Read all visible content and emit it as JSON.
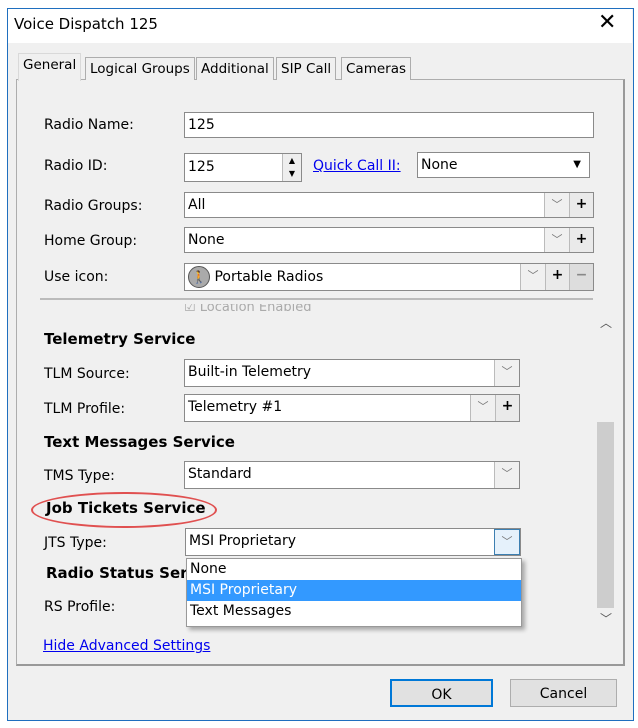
{
  "window": {
    "title": "Voice Dispatch 125",
    "close_icon": "close-icon"
  },
  "tabs": [
    {
      "label": "General"
    },
    {
      "label": "Logical Groups"
    },
    {
      "label": "Additional"
    },
    {
      "label": "SIP Call"
    },
    {
      "label": "Cameras"
    }
  ],
  "form": {
    "radio_name_label": "Radio Name:",
    "radio_name_value": "125",
    "radio_id_label": "Radio ID:",
    "radio_id_value": "125",
    "quick_call_label": "Quick Call II:",
    "quick_call_value": "None",
    "radio_groups_label": "Radio Groups:",
    "radio_groups_value": "All",
    "home_group_label": "Home Group:",
    "home_group_value": "None",
    "use_icon_label": "Use icon:",
    "use_icon_value": "Portable Radios",
    "location_enabled_label": "Location Enabled"
  },
  "telemetry": {
    "heading": "Telemetry Service",
    "source_label": "TLM Source:",
    "source_value": "Built-in Telemetry",
    "profile_label": "TLM Profile:",
    "profile_value": "Telemetry #1"
  },
  "text_messages": {
    "heading": "Text Messages Service",
    "type_label": "TMS Type:",
    "type_value": "Standard"
  },
  "job_tickets": {
    "heading": "Job Tickets Service",
    "type_label": "JTS Type:",
    "type_value": "MSI Proprietary",
    "options": [
      "None",
      "MSI Proprietary",
      "Text Messages"
    ],
    "highlighted": "MSI Proprietary",
    "highlight_color": "#3399ff",
    "annotation_color": "#e05050"
  },
  "radio_status": {
    "heading": "Radio Status Service",
    "profile_label": "RS Profile:"
  },
  "links": {
    "hide_advanced": "Hide Advanced Settings"
  },
  "buttons": {
    "ok": "OK",
    "cancel": "Cancel"
  }
}
